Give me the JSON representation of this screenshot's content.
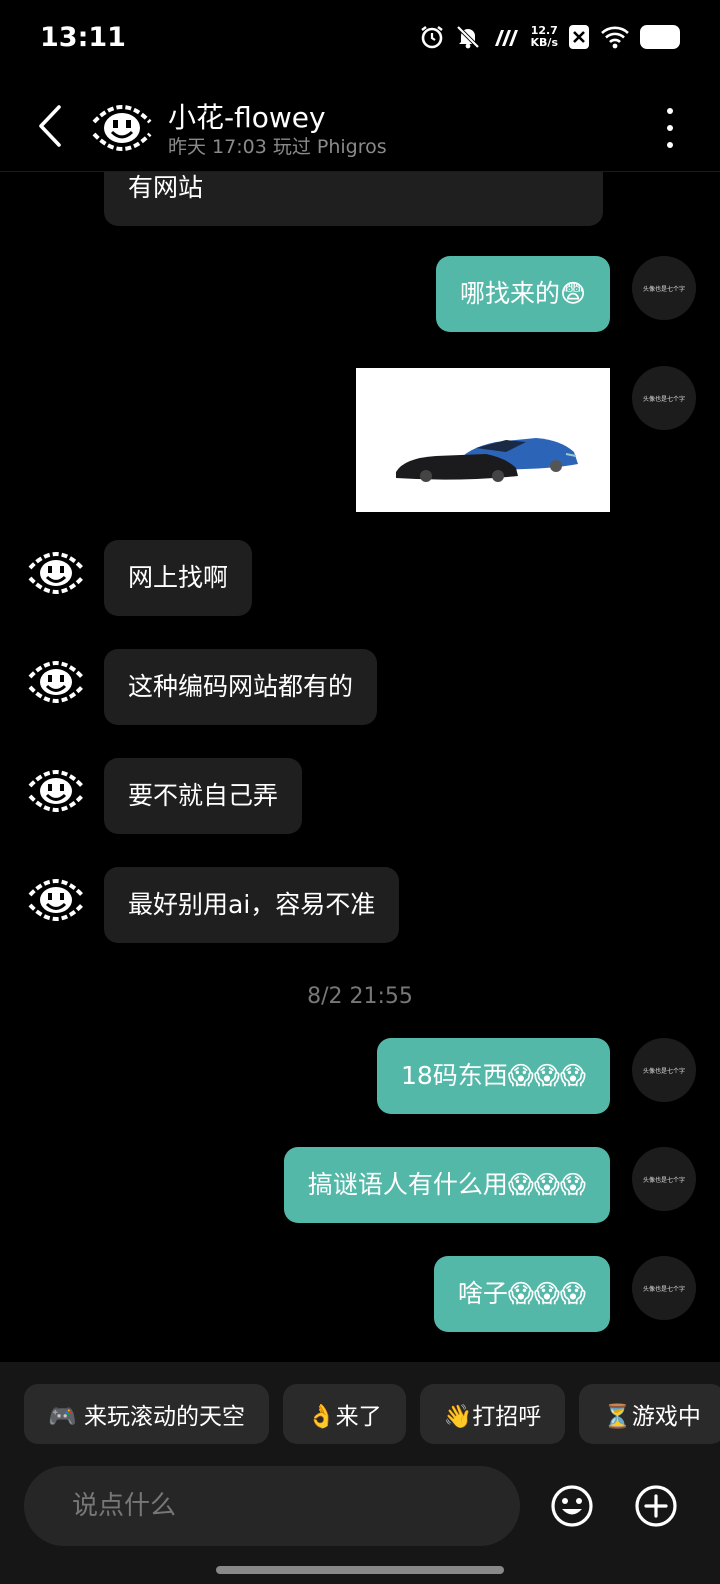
{
  "status": {
    "time": "13:11",
    "net_speed_value": "12.7",
    "net_speed_unit": "KB/s",
    "icons": [
      "alarm-icon",
      "mute-icon",
      "signal-icon",
      "net-speed",
      "no-sim-icon",
      "wifi-icon",
      "battery-icon"
    ]
  },
  "header": {
    "name": "小花-flowey",
    "subtitle": "昨天 17:03 玩过 Phigros"
  },
  "avatar": {
    "self_text": "头像也是七个字"
  },
  "messages": [
    {
      "side": "in",
      "text": "有网站"
    },
    {
      "side": "out",
      "text": "哪找来的😨"
    },
    {
      "side": "out",
      "type": "image",
      "image_icon": "sports-car-image"
    },
    {
      "side": "in",
      "text": "网上找啊"
    },
    {
      "side": "in",
      "text": "这种编码网站都有的"
    },
    {
      "side": "in",
      "text": "要不就自己弄"
    },
    {
      "side": "in",
      "text": "最好别用ai，容易不准"
    },
    {
      "side": "out",
      "text": "18码东西😱😱😱"
    },
    {
      "side": "out",
      "text": "搞谜语人有什么用😱😱😱"
    },
    {
      "side": "out",
      "text": "啥子😱😱😱"
    }
  ],
  "timestamp": "8/2  21:55",
  "quick_replies": [
    "🎮 来玩滚动的天空",
    "👌来了",
    "👋打招呼",
    "⏳游戏中"
  ],
  "input": {
    "placeholder": "说点什么"
  },
  "colors": {
    "outgoing_bubble": "#54b8a8",
    "incoming_bubble": "#1f1f1f",
    "background": "#000000"
  }
}
